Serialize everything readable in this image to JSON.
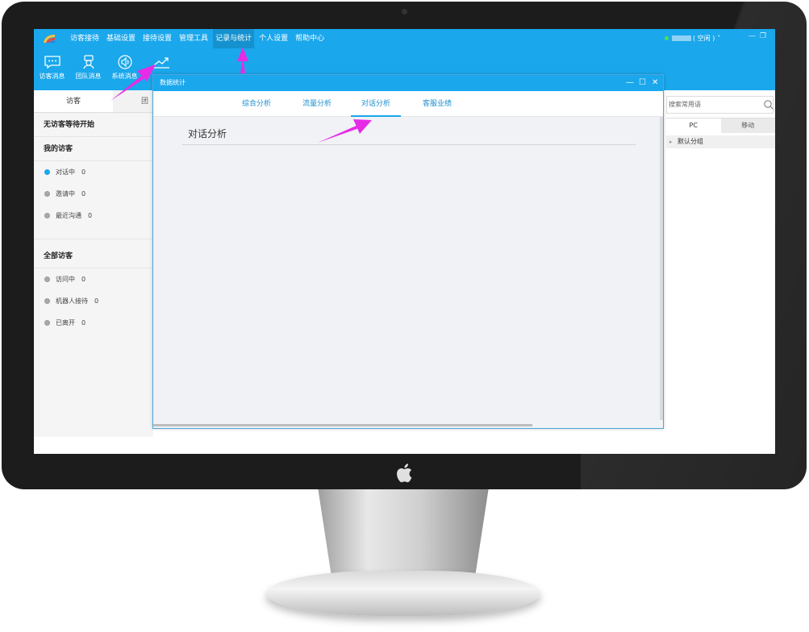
{
  "menu": {
    "items": [
      "访客接待",
      "基础设置",
      "接待设置",
      "管理工具",
      "记录与统计",
      "个人设置",
      "帮助中心"
    ],
    "active_index": 4
  },
  "status": {
    "text": "( 空闲 )",
    "caret": "˅",
    "dot_color": "#4ee04e"
  },
  "window_controls": {
    "minimize": "—",
    "restore": "❐"
  },
  "toolbar": [
    {
      "label": "访客消息",
      "icon": "chat-icon"
    },
    {
      "label": "团队消息",
      "icon": "team-icon"
    },
    {
      "label": "系统消息",
      "icon": "speaker-icon"
    },
    {
      "label": "",
      "icon": "chart-trend-icon"
    }
  ],
  "left_panel": {
    "tabs": [
      "访客",
      "团"
    ],
    "no_visitor_text": "无访客等待开始",
    "my_visitors": {
      "title": "我的访客",
      "rows": [
        {
          "label": "对话中",
          "count": "0"
        },
        {
          "label": "邀请中",
          "count": "0"
        },
        {
          "label": "最近沟通",
          "count": "0"
        }
      ]
    },
    "all_visitors": {
      "title": "全部访客",
      "rows": [
        {
          "label": "访问中",
          "count": "0"
        },
        {
          "label": "机器人接待",
          "count": "0"
        },
        {
          "label": "已离开",
          "count": "0"
        }
      ]
    }
  },
  "right_panel": {
    "search_placeholder": "搜索常用语",
    "tabs": [
      "PC",
      "移动"
    ],
    "group": "默认分组"
  },
  "dialog": {
    "title": "数据统计",
    "controls": {
      "minimize": "—",
      "maximize": "☐",
      "close": "✕"
    },
    "tabs": [
      "综合分析",
      "流量分析",
      "对话分析",
      "客服业绩"
    ],
    "active_tab_index": 2,
    "content_title": "对话分析"
  },
  "colors": {
    "accent": "#1aa7ec",
    "annotation_arrow": "#e62ce6"
  }
}
